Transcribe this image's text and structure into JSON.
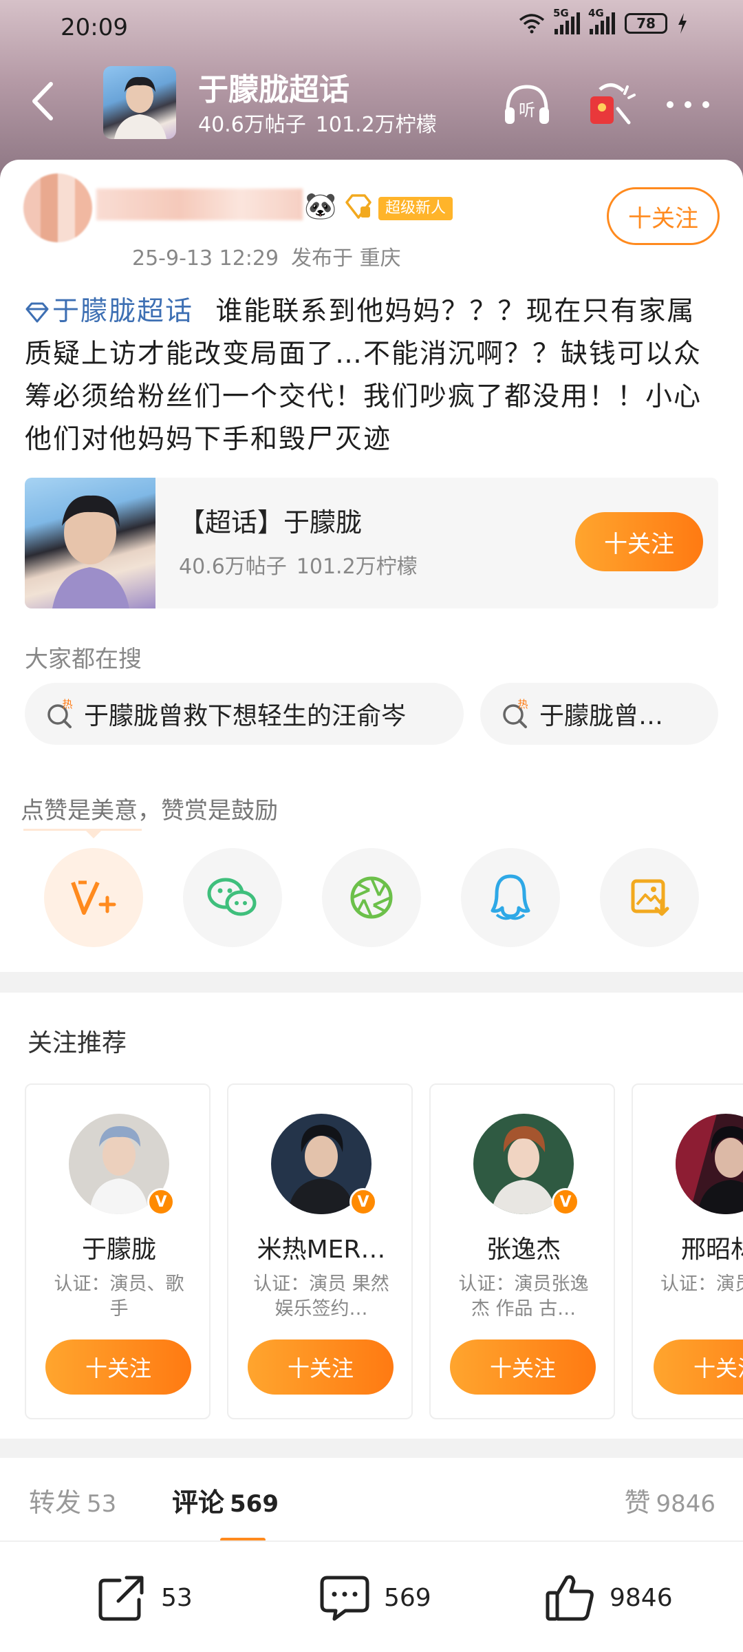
{
  "status": {
    "time": "20:09",
    "net1": "5G",
    "net2": "4G",
    "battery": "78"
  },
  "nav": {
    "title": "于朦胧超话",
    "posts": "40.6万帖子",
    "lemons": "101.2万柠檬",
    "listen_label": "听"
  },
  "post": {
    "badge": "超级新人",
    "date": "25-9-13 12:29",
    "location": "发布于 重庆",
    "follow_label": "十关注",
    "topic_link": "于朦胧超话",
    "text": "谁能联系到他妈妈？？？现在只有家属质疑上访才能改变局面了…不能消沉啊？？缺钱可以众筹必须给粉丝们一个交代！我们吵疯了都没用！！小心他们对他妈妈下手和毁尸灭迹"
  },
  "topic_card": {
    "name": "【超话】于朦胧",
    "posts": "40.6万帖子",
    "lemons": "101.2万柠檬",
    "follow_label": "十关注"
  },
  "search": {
    "title": "大家都在搜",
    "items": [
      "于朦胧曾救下想轻生的汪俞岑",
      "于朦胧曾…"
    ],
    "hot_label": "热"
  },
  "praise": {
    "text": "点赞是美意，赞赏是鼓励"
  },
  "recommend": {
    "title": "关注推荐",
    "users": [
      {
        "name": "于朦胧",
        "desc": "认证：演员、歌手",
        "follow": "十关注"
      },
      {
        "name": "米热MER…",
        "desc": "认证：演员 果然娱乐签约…",
        "follow": "十关注"
      },
      {
        "name": "张逸杰",
        "desc": "认证：演员张逸杰 作品 古…",
        "follow": "十关注"
      },
      {
        "name": "邢昭林",
        "desc": "认证：演员 邢昭林",
        "follow": "十关注"
      }
    ]
  },
  "tabs": {
    "repost_label": "转发",
    "repost_count": "53",
    "comment_label": "评论",
    "comment_count": "569",
    "like_label": "赞",
    "like_count": "9846"
  },
  "actions": {
    "repost": "53",
    "comment": "569",
    "like": "9846"
  },
  "colors": {
    "accent": "#ff8a1e",
    "topic_link": "#3d6fb3"
  }
}
